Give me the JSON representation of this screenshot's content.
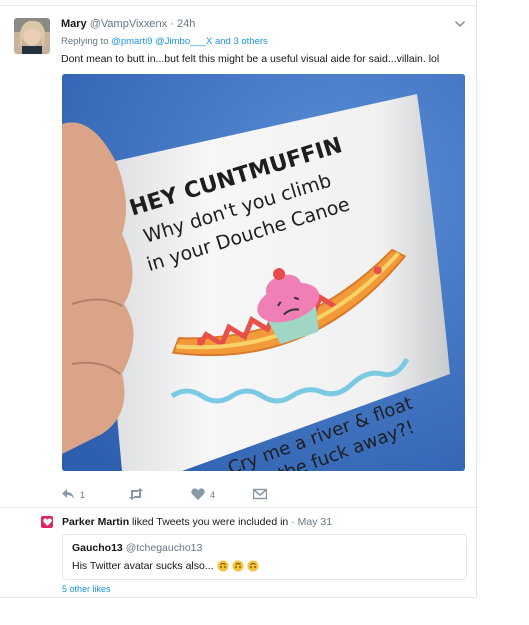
{
  "tweet": {
    "author_name": "Mary",
    "author_handle": "@VampVixxenx",
    "separator": "·",
    "time": "24h",
    "reply_prefix": "Replying to",
    "reply_handles": "@pmarti9 @Jimbo___X",
    "reply_suffix": "and 3 others",
    "text": "Dont mean to butt in...but felt this might be a useful visual aide for said...villain. lol",
    "media": {
      "mug_line1": "HEY CUNTMUFFIN",
      "mug_line2": "Why don't you climb",
      "mug_line3": "in your Douche Canoe",
      "mug_line4": "Cry me a river & float",
      "mug_line5": "the fuck away?!"
    },
    "actions": {
      "reply_count": "1",
      "retweet_count": "",
      "like_count": "4"
    },
    "icons": {
      "chevron": "chevron-down-icon",
      "reply": "reply-icon",
      "retweet": "retweet-icon",
      "like": "heart-icon",
      "dm": "direct-message-icon"
    }
  },
  "notification": {
    "name": "Parker Martin",
    "action_text": "liked Tweets you were included in",
    "separator": "·",
    "date": "May 31",
    "quoted": {
      "author_name": "Gaucho13",
      "author_handle": "@tchegaucho13",
      "text": "His Twitter avatar sucks also..."
    },
    "other_likes": "5 other likes"
  },
  "colors": {
    "link": "#1b95e0",
    "muted": "#657786",
    "heart": "#e0245e",
    "media_bg": "#3a6fc2"
  }
}
